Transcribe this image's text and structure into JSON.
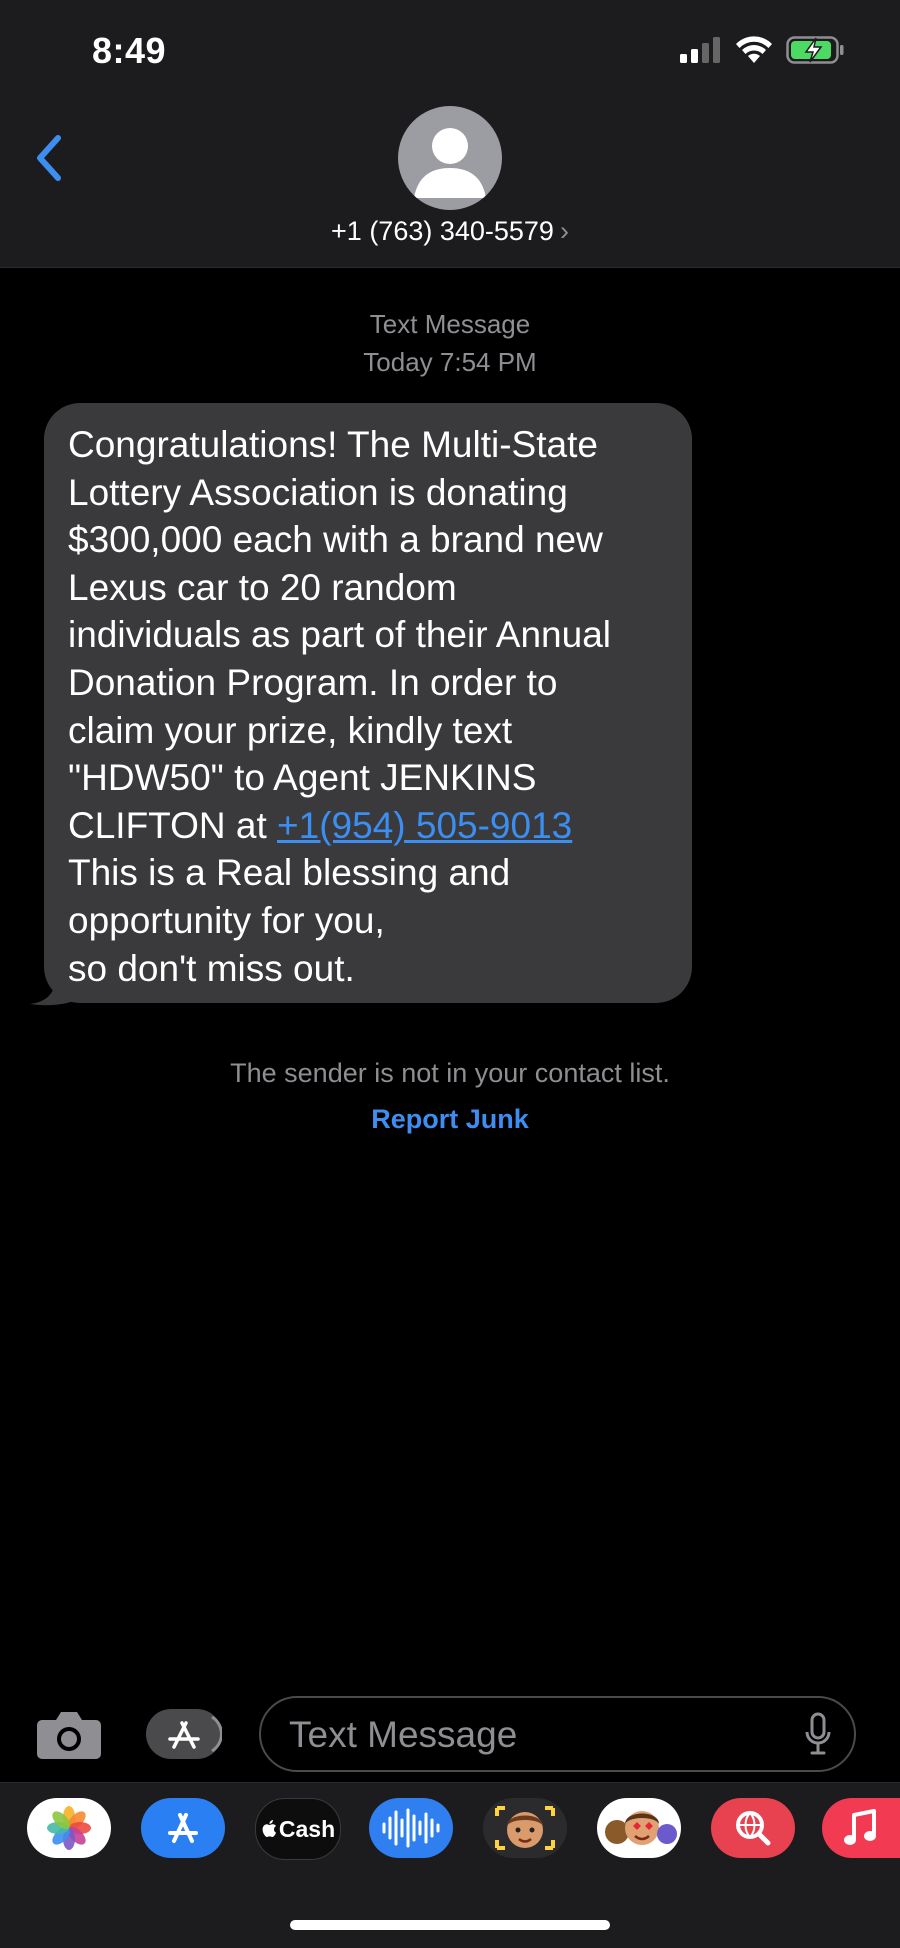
{
  "status_bar": {
    "time": "8:49"
  },
  "header": {
    "contact": "+1 (763) 340-5579"
  },
  "thread": {
    "service": "Text Message",
    "timestamp": "Today 7:54 PM",
    "message": {
      "line1": "Congratulations! The Multi-State",
      "line2": "Lottery Association is donating",
      "line3": "$300,000 each with a brand new",
      "line4": "Lexus car to 20 random",
      "line5": "individuals as part of their Annual",
      "line6": "Donation Program. In order to",
      "line7": "claim your prize, kindly text",
      "line8": "\"HDW50\" to Agent JENKINS",
      "line9_prefix": "CLIFTON at ",
      "phone_link": "+1(954) 505-9013",
      "line10": "This is a Real blessing and",
      "line11": "opportunity for you,",
      "line12": "so don't miss out."
    },
    "notice": "The sender is not in your contact list.",
    "report_junk": "Report Junk"
  },
  "composer": {
    "placeholder": "Text Message"
  },
  "app_strip": {
    "apps": [
      "photos-icon",
      "app-store-icon",
      "apple-cash-icon",
      "audio-message-icon",
      "memoji-icon",
      "memoji-stickers-icon",
      "web-images-search-icon",
      "music-icon"
    ],
    "cash_label": "Cash"
  },
  "colors": {
    "bubble": "#3a3a3c",
    "link": "#3b8ef2",
    "accent": "#3d8ef0",
    "background": "#000000"
  }
}
